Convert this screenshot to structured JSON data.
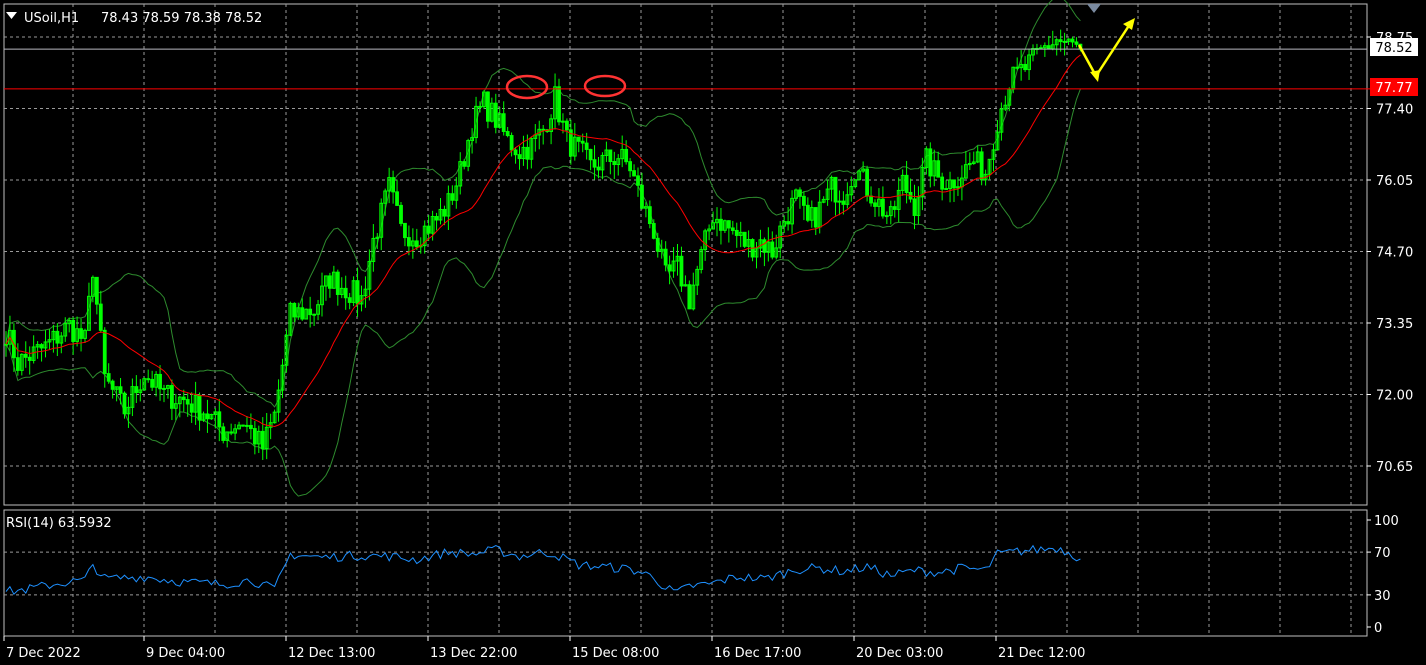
{
  "header": {
    "symbol": "USoil,H1",
    "ohlc": "78.43 78.59 78.38 78.52"
  },
  "rsi_panel": {
    "label": "RSI(14) 63.5932"
  },
  "price_tags": {
    "current": "78.52",
    "resistance": "77.77"
  },
  "colors": {
    "background": "#000000",
    "grid": "#c0c0c0",
    "candle": "#00ff00",
    "ma": "#ff0000",
    "bollinger": "#2e8b2e",
    "rsi": "#1e90ff",
    "resistance": "#ff0000",
    "current_line": "#b8b8c0",
    "arrow": "#ffff00",
    "circle": "#ff3333"
  },
  "chart_data": [
    {
      "type": "candlestick",
      "symbol": "USoil",
      "timeframe": "H1",
      "y_ticks": [
        "78.75",
        "77.40",
        "76.05",
        "74.70",
        "73.35",
        "72.00",
        "70.65"
      ],
      "ylim": [
        70.0,
        79.0
      ],
      "x_ticks": [
        "7 Dec 2022",
        "9 Dec 04:00",
        "12 Dec 13:00",
        "13 Dec 22:00",
        "15 Dec 08:00",
        "16 Dec 17:00",
        "20 Dec 03:00",
        "21 Dec 12:00"
      ],
      "grid": true,
      "close_path": [
        [
          0,
          73.2
        ],
        [
          3,
          72.6
        ],
        [
          10,
          72.9
        ],
        [
          16,
          73.3
        ],
        [
          20,
          73.0
        ],
        [
          22,
          74.4
        ],
        [
          25,
          72.3
        ],
        [
          30,
          71.7
        ],
        [
          35,
          72.4
        ],
        [
          40,
          72.0
        ],
        [
          45,
          71.9
        ],
        [
          50,
          71.7
        ],
        [
          55,
          71.3
        ],
        [
          60,
          71.5
        ],
        [
          65,
          71.0
        ],
        [
          68,
          71.6
        ],
        [
          72,
          73.5
        ],
        [
          78,
          73.6
        ],
        [
          82,
          74.2
        ],
        [
          86,
          74.0
        ],
        [
          90,
          73.8
        ],
        [
          93,
          74.9
        ],
        [
          97,
          75.9
        ],
        [
          100,
          75.1
        ],
        [
          104,
          75.0
        ],
        [
          109,
          75.3
        ],
        [
          112,
          75.6
        ],
        [
          115,
          76.2
        ],
        [
          118,
          77.1
        ],
        [
          121,
          77.5
        ],
        [
          124,
          77.2
        ],
        [
          127,
          76.8
        ],
        [
          130,
          76.6
        ],
        [
          133,
          76.7
        ],
        [
          136,
          77.0
        ],
        [
          139,
          77.6
        ],
        [
          142,
          76.8
        ],
        [
          145,
          76.6
        ],
        [
          148,
          76.3
        ],
        [
          151,
          76.4
        ],
        [
          155,
          76.5
        ],
        [
          158,
          76.3
        ],
        [
          161,
          75.6
        ],
        [
          164,
          75.1
        ],
        [
          167,
          74.2
        ],
        [
          170,
          74.4
        ],
        [
          173,
          73.8
        ],
        [
          176,
          74.6
        ],
        [
          179,
          75.4
        ],
        [
          182,
          75.2
        ],
        [
          185,
          75.0
        ],
        [
          188,
          74.8
        ],
        [
          191,
          74.9
        ],
        [
          194,
          74.7
        ],
        [
          197,
          75.3
        ],
        [
          200,
          75.7
        ],
        [
          203,
          75.2
        ],
        [
          206,
          75.5
        ],
        [
          209,
          75.9
        ],
        [
          212,
          75.8
        ],
        [
          215,
          76.3
        ],
        [
          218,
          75.9
        ],
        [
          221,
          75.6
        ],
        [
          224,
          75.3
        ],
        [
          227,
          76.0
        ],
        [
          230,
          75.6
        ],
        [
          233,
          76.4
        ],
        [
          236,
          76.1
        ],
        [
          239,
          76.0
        ],
        [
          242,
          76.2
        ],
        [
          245,
          76.4
        ],
        [
          248,
          76.2
        ],
        [
          251,
          77.2
        ],
        [
          254,
          77.9
        ],
        [
          257,
          78.1
        ],
        [
          260,
          78.3
        ],
        [
          263,
          78.55
        ],
        [
          266,
          78.7
        ],
        [
          269,
          78.6
        ],
        [
          272,
          78.52
        ]
      ],
      "overlays": [
        "Bollinger Bands",
        "Moving Average"
      ],
      "resistance_level": 77.77,
      "current_price": 78.52,
      "last_bar": {
        "open": 78.43,
        "high": 78.59,
        "low": 78.38,
        "close": 78.52
      }
    },
    {
      "type": "line",
      "indicator": "RSI(14)",
      "value": 63.5932,
      "ylim": [
        0,
        100
      ],
      "y_ticks": [
        "100",
        "70",
        "30",
        "0"
      ],
      "x": [
        0,
        5,
        12,
        20,
        22,
        25,
        35,
        45,
        55,
        62,
        68,
        72,
        80,
        90,
        97,
        104,
        112,
        118,
        124,
        130,
        136,
        139,
        145,
        152,
        158,
        164,
        167,
        170,
        173,
        178,
        185,
        192,
        200,
        206,
        212,
        218,
        224,
        230,
        236,
        242,
        248,
        251,
        257,
        263,
        266,
        269,
        272
      ],
      "values": [
        33,
        35,
        40,
        44,
        58,
        45,
        47,
        42,
        40,
        44,
        35,
        68,
        65,
        67,
        66,
        63,
        70,
        68,
        72,
        66,
        70,
        68,
        58,
        56,
        54,
        47,
        36,
        32,
        38,
        40,
        47,
        45,
        54,
        55,
        52,
        56,
        48,
        53,
        51,
        55,
        53,
        68,
        71,
        73,
        74,
        70,
        64
      ]
    }
  ]
}
